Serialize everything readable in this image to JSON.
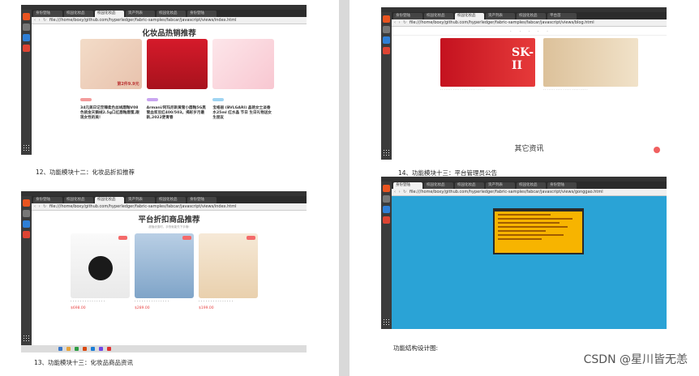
{
  "browser": {
    "tabs_short": [
      "身份登陆",
      "校园化妆品",
      "资产列表",
      "校园化妆品",
      "身份登陆",
      "校园化妆品",
      "平台首"
    ],
    "tab_top_label": "化妆品热销推荐"
  },
  "screens": {
    "s1": {
      "url": "file:///home/boxy/github.com/hyperledger/fabric-samples/fabcar/javascript/views/index.html",
      "title": "化妆品热销推荐",
      "products": [
        {
          "text": "34元美日记至臻柔色丝绒唇釉V08色挑金天鹅绒2.5g口红唇釉唇蜜,跟现女性的美!",
          "promo": "第2件9.9元"
        },
        {
          "text": "Armani/阿玛尼新黄管小唇釉5G黑管血浆豆红400/503。揭彩岁月最新,2022更青春",
          "promo": ""
        },
        {
          "text": "宝格丽 (BVLGARI) 晶艳女士淡香水25ml 红水晶 节日 生日礼物送女生朋友",
          "promo": ""
        }
      ]
    },
    "s2": {
      "url": "file:///home/boxy/github.com/hyperledger/fabric-samples/fabcar/javascript/views/blog.html",
      "brand": "SK-II",
      "section_title": "其它资讯"
    },
    "s3": {
      "url": "file:///home/boxy/github.com/hyperledger/fabric-samples/fabcar/javascript/views/index.html",
      "title": "平台折扣商品推荐",
      "subtitle": "超值优惠时，手快就能先下手哦!",
      "prices": [
        "$698.00",
        "$289.00",
        "$199.00"
      ]
    },
    "s4": {
      "url": "file:///home/boxy/github.com/hyperledger/fabric-samples/fabcar/javascript/views/gonggao.html"
    }
  },
  "captions": {
    "c1": "12、功能模块十二：化妆品折扣推荐",
    "c2": "14、功能模块十三：平台管理员公告",
    "c3": "13、功能模块十三：化妆品商品资讯",
    "c4": "功能结构设计图:"
  },
  "watermark": "CSDN @星川皆无恙"
}
